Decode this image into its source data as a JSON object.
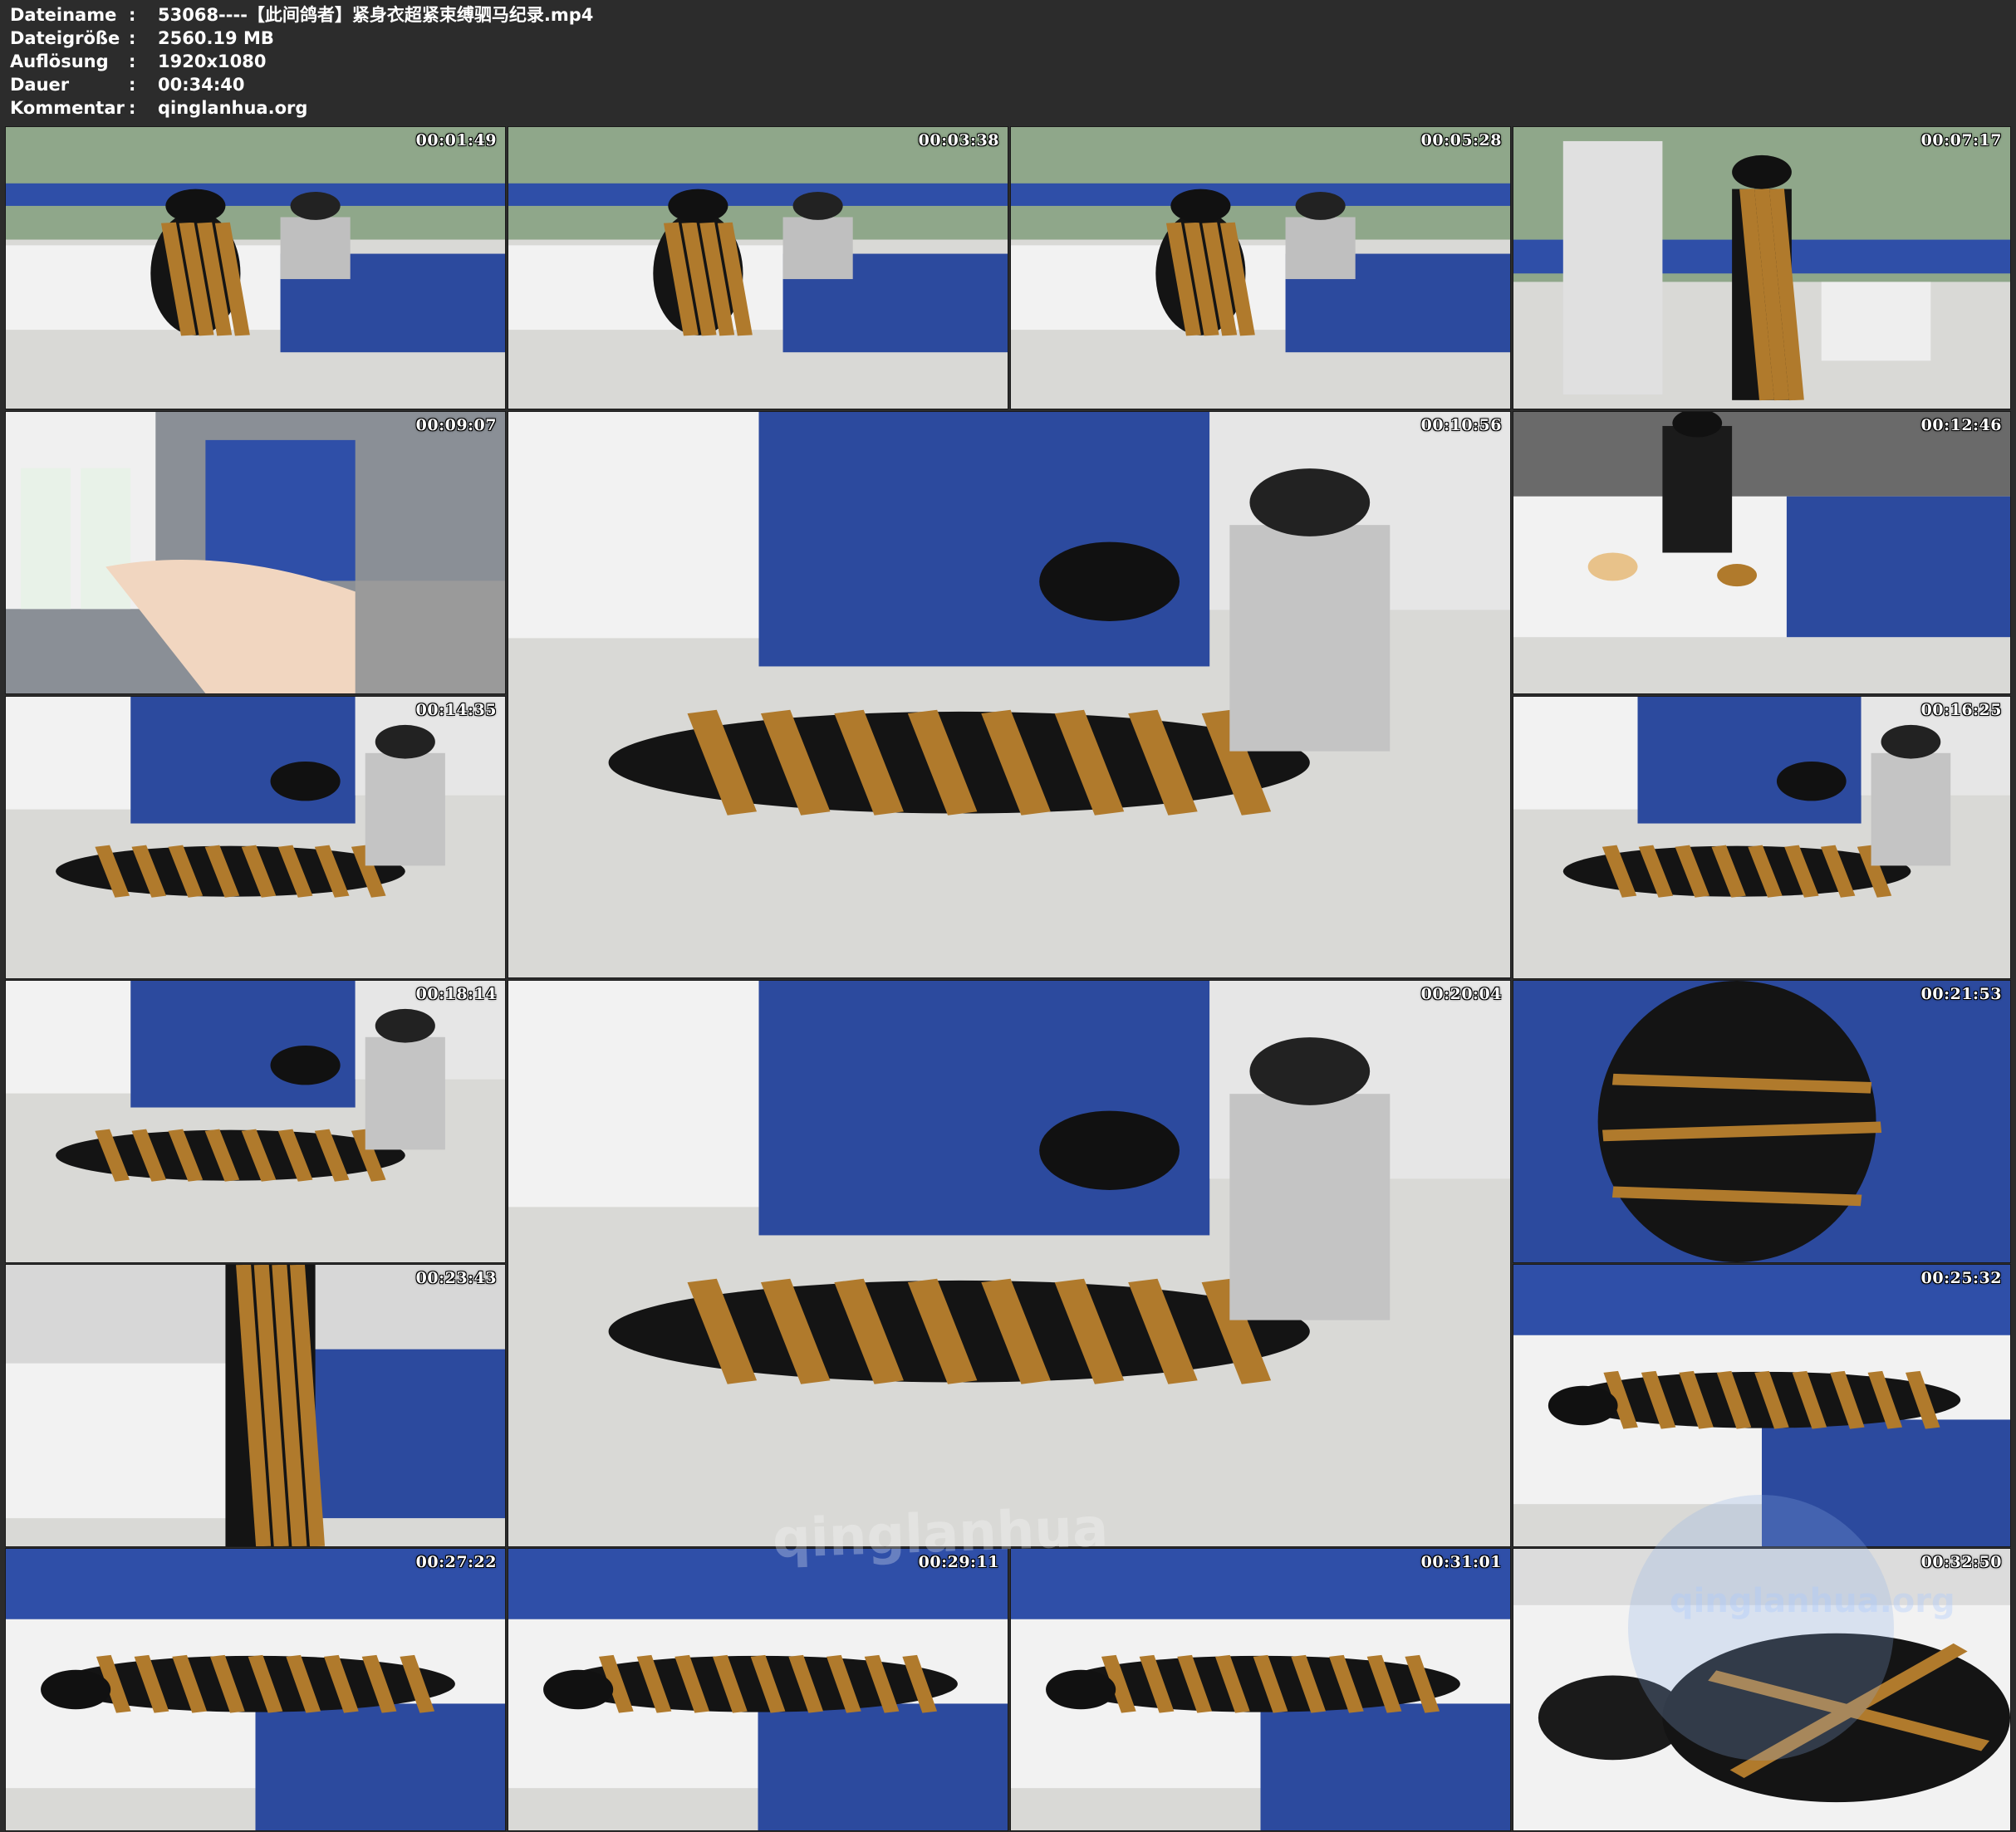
{
  "header": {
    "rows": [
      {
        "label": "Dateiname",
        "colon": ":",
        "value": "53068----【此间鸽者】紧身衣超紧束缚驷马纪录.mp4"
      },
      {
        "label": "Dateigröße",
        "colon": ":",
        "value": "2560.19 MB"
      },
      {
        "label": "Auflösung",
        "colon": ":",
        "value": "1920x1080"
      },
      {
        "label": "Dauer",
        "colon": ":",
        "value": "00:34:40"
      },
      {
        "label": "Kommentar",
        "colon": ":",
        "value": "qinglanhua.org"
      }
    ]
  },
  "thumbnails": [
    {
      "timestamp": "00:01:49",
      "scene": "bedroom-seated"
    },
    {
      "timestamp": "00:03:38",
      "scene": "bedroom-seated"
    },
    {
      "timestamp": "00:05:28",
      "scene": "bedroom-bed"
    },
    {
      "timestamp": "00:07:17",
      "scene": "standing"
    },
    {
      "timestamp": "00:09:07",
      "scene": "closeup-bottles"
    },
    {
      "timestamp": "00:10:56",
      "scene": "floor-sitting"
    },
    {
      "timestamp": "00:12:46",
      "scene": "bed-items"
    },
    {
      "timestamp": "00:14:35",
      "scene": "floor-lying"
    },
    {
      "timestamp": "00:16:25",
      "scene": "floor-lying"
    },
    {
      "timestamp": "00:18:14",
      "scene": "floor-lying"
    },
    {
      "timestamp": "00:20:04",
      "scene": "floor-crouch"
    },
    {
      "timestamp": "00:21:53",
      "scene": "closeup-back"
    },
    {
      "timestamp": "00:23:43",
      "scene": "bed-standing"
    },
    {
      "timestamp": "00:25:32",
      "scene": "bed-lying"
    },
    {
      "timestamp": "00:27:22",
      "scene": "bed-lying"
    },
    {
      "timestamp": "00:29:11",
      "scene": "bed-lying"
    },
    {
      "timestamp": "00:31:01",
      "scene": "bed-lying"
    },
    {
      "timestamp": "00:32:50",
      "scene": "closeup-face"
    }
  ],
  "watermark": {
    "text": "qinglanhua",
    "text_small": "qinglanhua.org"
  },
  "colors": {
    "background": "#2c2c2c",
    "wall_blue": "#2f4fa8",
    "wall_green": "#8fa78a",
    "floor": "#d9d9d6",
    "bed": "#f2f2f2",
    "blanket": "#2c4a9e",
    "suit": "#141414",
    "rope": "#b07a2c"
  }
}
